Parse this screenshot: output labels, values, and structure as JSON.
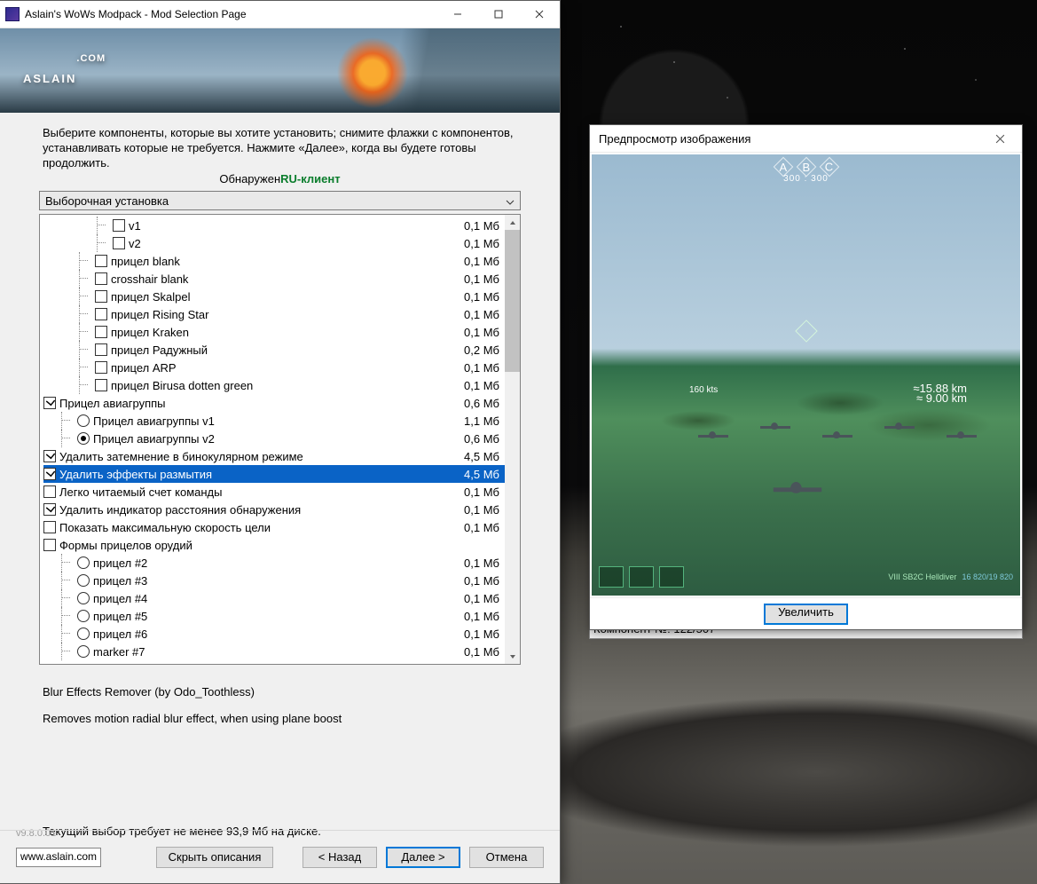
{
  "window": {
    "title": "Aslain's WoWs Modpack - Mod Selection Page",
    "logo": "ASLAIN",
    "logo_tld": ".COM"
  },
  "instructions": "Выберите компоненты, которые вы хотите установить; снимите флажки с компонентов, устанавливать которые не требуется. Нажмите «Далее», когда вы будете готовы продолжить.",
  "detected_prefix": "Обнаружен",
  "detected_client": "RU-клиент",
  "combo": {
    "value": "Выборочная установка"
  },
  "tree": [
    {
      "indent": 6,
      "ctrl": "chk",
      "checked": false,
      "label": "v1",
      "size": "0,1 Мб"
    },
    {
      "indent": 6,
      "ctrl": "chk",
      "checked": false,
      "label": "v2",
      "size": "0,1 Мб"
    },
    {
      "indent": 4,
      "ctrl": "chk",
      "checked": false,
      "label": "прицел blank",
      "size": "0,1 Мб"
    },
    {
      "indent": 4,
      "ctrl": "chk",
      "checked": false,
      "label": "crosshair blank",
      "size": "0,1 Мб"
    },
    {
      "indent": 4,
      "ctrl": "chk",
      "checked": false,
      "label": "прицел Skalpel",
      "size": "0,1 Мб"
    },
    {
      "indent": 4,
      "ctrl": "chk",
      "checked": false,
      "label": "прицел Rising Star",
      "size": "0,1 Мб"
    },
    {
      "indent": 4,
      "ctrl": "chk",
      "checked": false,
      "label": "прицел Kraken",
      "size": "0,1 Мб"
    },
    {
      "indent": 4,
      "ctrl": "chk",
      "checked": false,
      "label": "прицел Радужный",
      "size": "0,2 Мб"
    },
    {
      "indent": 4,
      "ctrl": "chk",
      "checked": false,
      "label": "прицел ARP",
      "size": "0,1 Мб"
    },
    {
      "indent": 4,
      "ctrl": "chk",
      "checked": false,
      "label": "прицел Birusa dotten green",
      "size": "0,1 Мб"
    },
    {
      "indent": 0,
      "ctrl": "chk",
      "checked": true,
      "label": "Прицел авиагруппы",
      "size": "0,6 Мб"
    },
    {
      "indent": 2,
      "ctrl": "radio",
      "checked": false,
      "label": "Прицел авиагруппы v1",
      "size": "1,1 Мб"
    },
    {
      "indent": 2,
      "ctrl": "radio",
      "checked": true,
      "label": "Прицел авиагруппы v2",
      "size": "0,6 Мб"
    },
    {
      "indent": 0,
      "ctrl": "chk",
      "checked": true,
      "label": "Удалить затемнение в бинокулярном режиме",
      "size": "4,5 Мб"
    },
    {
      "indent": 0,
      "ctrl": "chk",
      "checked": true,
      "label": "Удалить эффекты размытия",
      "size": "4,5 Мб",
      "selected": true
    },
    {
      "indent": 0,
      "ctrl": "chk",
      "checked": false,
      "label": "Легко читаемый счет команды",
      "size": "0,1 Мб"
    },
    {
      "indent": 0,
      "ctrl": "chk",
      "checked": true,
      "label": "Удалить индикатор расстояния обнаружения",
      "size": "0,1 Мб"
    },
    {
      "indent": 0,
      "ctrl": "chk",
      "checked": false,
      "label": "Показать максимальную скорость цели",
      "size": "0,1 Мб"
    },
    {
      "indent": 0,
      "ctrl": "chk",
      "checked": false,
      "label": "Формы прицелов орудий",
      "size": ""
    },
    {
      "indent": 2,
      "ctrl": "radio",
      "checked": false,
      "label": "прицел #2",
      "size": "0,1 Мб"
    },
    {
      "indent": 2,
      "ctrl": "radio",
      "checked": false,
      "label": "прицел #3",
      "size": "0,1 Мб"
    },
    {
      "indent": 2,
      "ctrl": "radio",
      "checked": false,
      "label": "прицел #4",
      "size": "0,1 Мб"
    },
    {
      "indent": 2,
      "ctrl": "radio",
      "checked": false,
      "label": "прицел #5",
      "size": "0,1 Мб"
    },
    {
      "indent": 2,
      "ctrl": "radio",
      "checked": false,
      "label": "прицел #6",
      "size": "0,1 Мб"
    },
    {
      "indent": 2,
      "ctrl": "radio",
      "checked": false,
      "label": "marker #7",
      "size": "0,1 Мб"
    }
  ],
  "description": {
    "line1": "Blur Effects Remover (by Odo_Toothless)",
    "line2": "Removes motion radial blur effect, when using plane boost"
  },
  "requirement": "Текущий выбор требует не менее 93,9 Мб на диске.",
  "version": "v9.8.0.01",
  "url": "www.aslain.com",
  "buttons": {
    "hide_desc": "Скрыть описания",
    "back": "< Назад",
    "next": "Далее >",
    "cancel": "Отмена"
  },
  "preview": {
    "title": "Предпросмотр изображения",
    "zoom": "Увеличить",
    "speed": "160 kts",
    "dist1": "≈15.88 km",
    "dist2": "≈ 9.00 km",
    "score": "300 : 300",
    "ship": "VIII SB2C Helldiver",
    "hp": "16 820/19 820"
  },
  "component_counter": "Компонент №: 122/507"
}
